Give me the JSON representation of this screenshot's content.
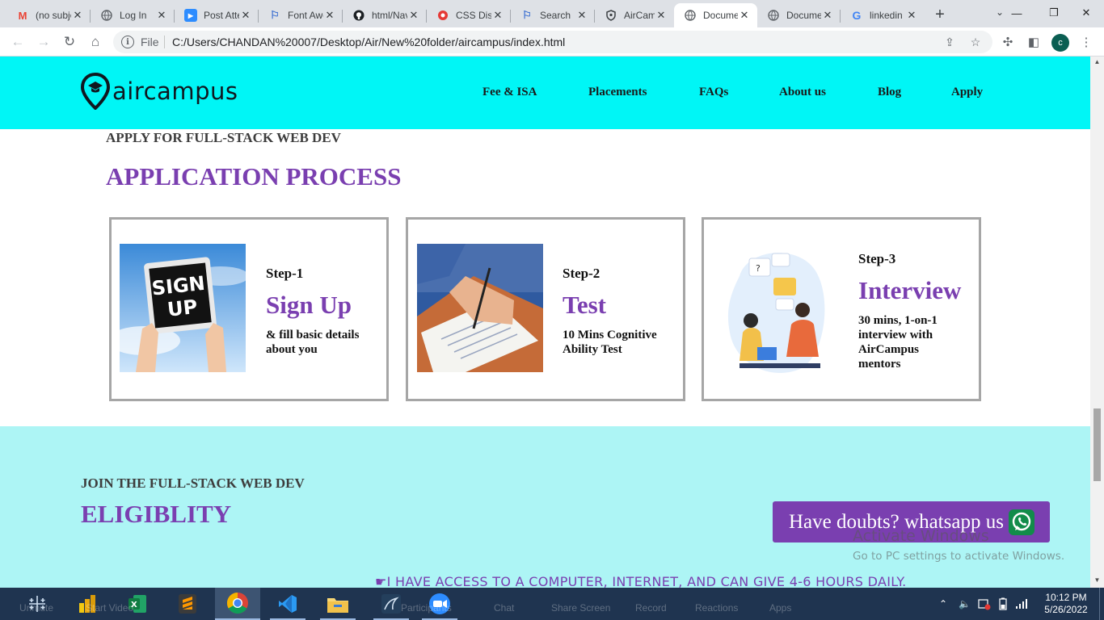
{
  "browser": {
    "tabs": [
      {
        "title": "(no subject)",
        "icon": "gmail-icon",
        "active": false
      },
      {
        "title": "Log In",
        "icon": "globe-icon",
        "active": false
      },
      {
        "title": "Post Attendee",
        "icon": "zoom-icon",
        "active": false
      },
      {
        "title": "Font Awesome",
        "icon": "flag-icon",
        "active": false
      },
      {
        "title": "html/Navbar",
        "icon": "github-icon",
        "active": false
      },
      {
        "title": "CSS Display",
        "icon": "record-icon",
        "active": false
      },
      {
        "title": "Search",
        "icon": "flag-icon",
        "active": false
      },
      {
        "title": "AirCampus",
        "icon": "shield-icon",
        "active": false
      },
      {
        "title": "Document",
        "icon": "globe-icon",
        "active": true
      },
      {
        "title": "Document",
        "icon": "globe-icon",
        "active": false
      },
      {
        "title": "linkedin",
        "icon": "google-icon",
        "active": false
      }
    ],
    "address": {
      "scheme_label": "File",
      "url": "C:/Users/CHANDAN%20007/Desktop/Air/New%20folder/aircampus/index.html"
    },
    "profile_initial": "c"
  },
  "site": {
    "logo_text": "aircampus",
    "nav": [
      "Fee & ISA",
      "Placements",
      "FAQs",
      "About us",
      "Blog",
      "Apply"
    ]
  },
  "application": {
    "eyebrow": "APPLY FOR FULL-STACK WEB DEV",
    "heading": "APPLICATION PROCESS",
    "steps": [
      {
        "step": "Step-1",
        "title": "Sign Up",
        "desc": "& fill basic details about you",
        "image_text": [
          "SIGN",
          "UP"
        ]
      },
      {
        "step": "Step-2",
        "title": "Test",
        "desc": "10 Mins Cognitive Ability Test"
      },
      {
        "step": "Step-3",
        "title": "Interview",
        "desc": "30 mins, 1-on-1 interview with AirCampus mentors"
      }
    ]
  },
  "eligibility": {
    "eyebrow": "JOIN THE FULL-STACK WEB DEV",
    "heading": "ELIGIBLITY",
    "criteria": "I have access to a computer, internet, and can give 4-6 hours daily.",
    "whatsapp_label": "Have doubts? whatsapp us"
  },
  "watermark": {
    "title": "Activate Windows",
    "subtitle": "Go to PC settings to activate Windows."
  },
  "taskbar": {
    "ghost_labels": [
      "Unmute",
      "Start Video",
      "Participants",
      "Chat",
      "Share Screen",
      "Record",
      "Reactions",
      "Apps"
    ],
    "clock_time": "10:12 PM",
    "clock_date": "5/26/2022"
  },
  "colors": {
    "header_bg": "#00f6f6",
    "accent_purple": "#7a3fb0",
    "eligibility_bg": "#adf5f5",
    "taskbar_bg": "#1f3450"
  }
}
